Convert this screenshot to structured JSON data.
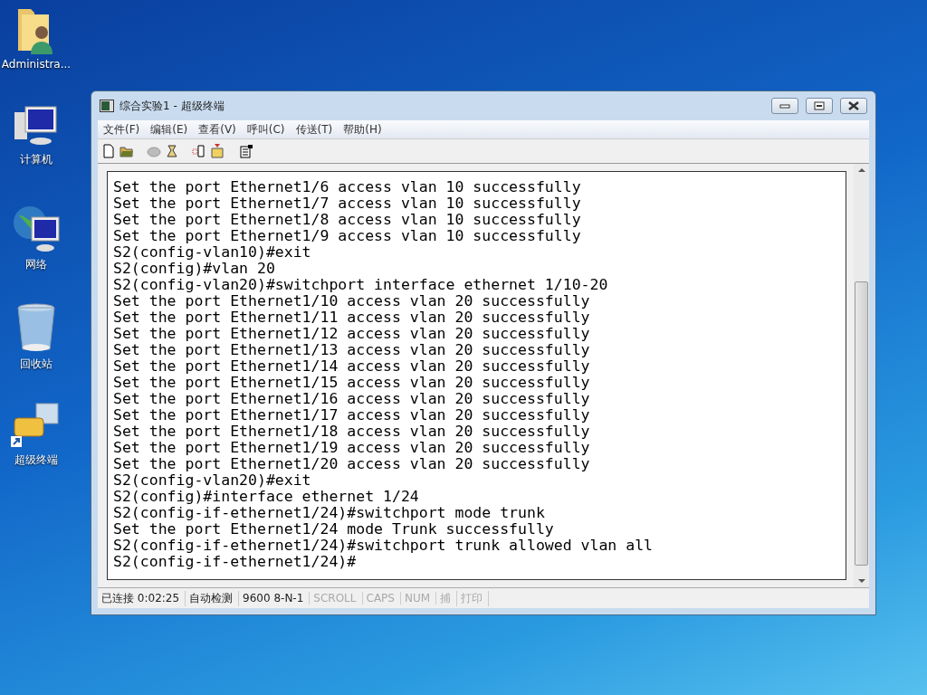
{
  "desktop_icons": [
    {
      "kind": "user-folder",
      "label": "Administra..."
    },
    {
      "kind": "computer",
      "label": "计算机"
    },
    {
      "kind": "network",
      "label": "网络"
    },
    {
      "kind": "recycle-bin",
      "label": "回收站"
    },
    {
      "kind": "terminal-shortcut",
      "label": "超级终端"
    }
  ],
  "window": {
    "title": "综合实验1 - 超级终端",
    "menu": [
      "文件(F)",
      "编辑(E)",
      "查看(V)",
      "呼叫(C)",
      "传送(T)",
      "帮助(H)"
    ],
    "terminal_lines": [
      "Set the port Ethernet1/6 access vlan 10 successfully",
      "Set the port Ethernet1/7 access vlan 10 successfully",
      "Set the port Ethernet1/8 access vlan 10 successfully",
      "Set the port Ethernet1/9 access vlan 10 successfully",
      "S2(config-vlan10)#exit",
      "S2(config)#vlan 20",
      "S2(config-vlan20)#switchport interface ethernet 1/10-20",
      "Set the port Ethernet1/10 access vlan 20 successfully",
      "Set the port Ethernet1/11 access vlan 20 successfully",
      "Set the port Ethernet1/12 access vlan 20 successfully",
      "Set the port Ethernet1/13 access vlan 20 successfully",
      "Set the port Ethernet1/14 access vlan 20 successfully",
      "Set the port Ethernet1/15 access vlan 20 successfully",
      "Set the port Ethernet1/16 access vlan 20 successfully",
      "Set the port Ethernet1/17 access vlan 20 successfully",
      "Set the port Ethernet1/18 access vlan 20 successfully",
      "Set the port Ethernet1/19 access vlan 20 successfully",
      "Set the port Ethernet1/20 access vlan 20 successfully",
      "S2(config-vlan20)#exit",
      "S2(config)#interface ethernet 1/24",
      "S2(config-if-ethernet1/24)#switchport mode trunk",
      "Set the port Ethernet1/24 mode Trunk successfully",
      "S2(config-if-ethernet1/24)#switchport trunk allowed vlan all",
      "S2(config-if-ethernet1/24)#"
    ],
    "status_bar": [
      {
        "text": "已连接 0:02:25",
        "disabled": false
      },
      {
        "text": "自动检测",
        "disabled": false
      },
      {
        "text": "9600 8-N-1",
        "disabled": false
      },
      {
        "text": "SCROLL",
        "disabled": true
      },
      {
        "text": "CAPS",
        "disabled": true
      },
      {
        "text": "NUM",
        "disabled": true
      },
      {
        "text": "捕",
        "disabled": true
      },
      {
        "text": "打印",
        "disabled": true
      }
    ]
  }
}
